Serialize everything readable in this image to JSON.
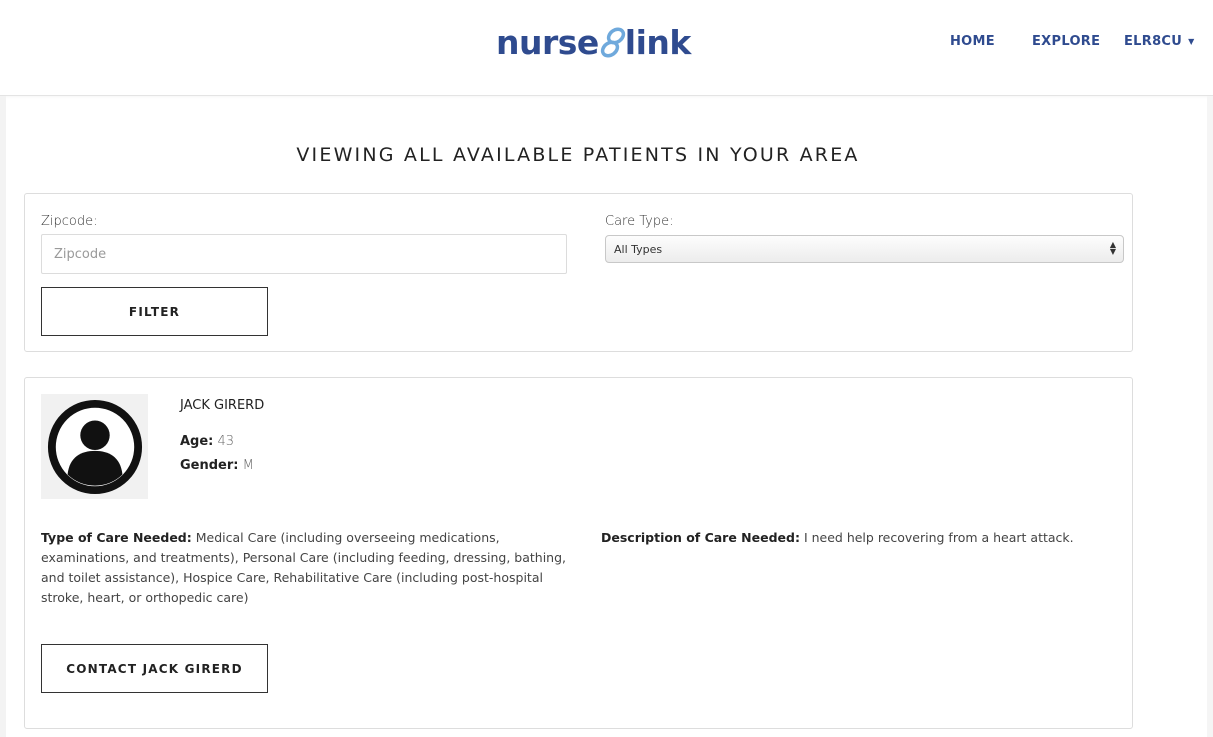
{
  "brand": {
    "part1": "nurse",
    "part2": "link",
    "color": "#2f4b8f",
    "accent": "#6fa9dc"
  },
  "nav": {
    "home": "HOME",
    "explore": "EXPLORE",
    "user": "ELR8CU"
  },
  "page_title": "VIEWING ALL AVAILABLE PATIENTS IN YOUR AREA",
  "filter": {
    "zip_label": "Zipcode:",
    "zip_placeholder": "Zipcode",
    "zip_value": "",
    "care_type_label": "Care Type:",
    "care_type_selected": "All Types",
    "filter_button": "FILTER"
  },
  "patient": {
    "name": "JACK GIRERD",
    "age_label": "Age:",
    "age": "43",
    "gender_label": "Gender:",
    "gender": "M",
    "care_type_label": "Type of Care Needed:",
    "care_type_text": "Medical Care (including overseeing medications, examinations, and treatments), Personal Care (including feeding, dressing, bathing, and toilet assistance), Hospice Care, Rehabilitative Care (including post-hospital stroke, heart, or orthopedic care)",
    "description_label": "Description of Care Needed:",
    "description_text": "I need help recovering from a heart attack.",
    "contact_button": "CONTACT JACK GIRERD",
    "avatar_icon": "user-avatar-icon"
  }
}
